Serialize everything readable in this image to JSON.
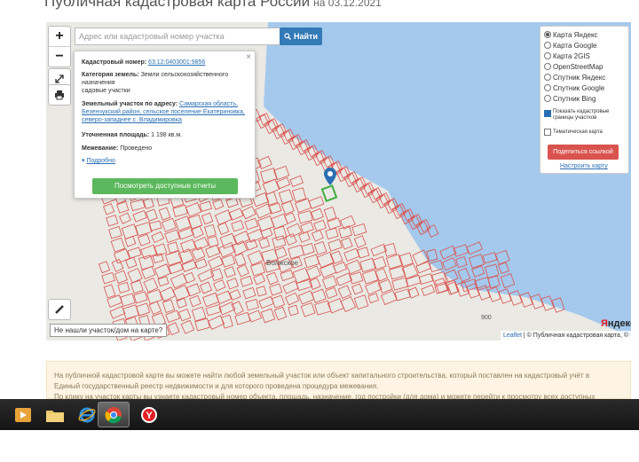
{
  "page": {
    "title": "Публичная кадастровая карта России",
    "date": "на 03.12.2021"
  },
  "map": {
    "search_placeholder": "Адрес или кадастровый номер участка",
    "search_button": "Найти",
    "zoom_in": "+",
    "zoom_out": "−",
    "village_label": "Волжское",
    "plot_label_900": "900",
    "not_found": "Не нашли участок/дом на карте?",
    "attribution_leaflet": "Leaflet",
    "attribution_rest": "| © Публичная кадастровая карта, ©",
    "yandex_logo_y": "Я",
    "yandex_logo_rest": "ндекс",
    "colors": {
      "water": "#a5c9ec",
      "plot_lines": "#d9534f",
      "selected_plot": "#3fae3f"
    }
  },
  "popup": {
    "close": "×",
    "cadastral_label": "Кадастровый номер:",
    "cadastral_value": "63:12:0403001:9856",
    "category_label": "Категория земель:",
    "category_value": "Земли сельскохозяйственного назначения",
    "category_use": "садовые участки",
    "address_label": "Земельный участок по адресу:",
    "address_value": "Самарская область, Безенчукский район, сельское поселение Екатериновка, северо-западнее с. Владимировка",
    "area_label": "Уточненная площадь:",
    "area_value": "1 198 кв.м.",
    "survey_label": "Межевание:",
    "survey_value": "Проведено",
    "more_link": "Подробно",
    "reports_button": "Посмотреть доступные отчеты"
  },
  "layers": {
    "options": [
      {
        "label": "Карта Яндекс",
        "selected": true
      },
      {
        "label": "Карта Google",
        "selected": false
      },
      {
        "label": "Карта 2GIS",
        "selected": false
      },
      {
        "label": "OpenStreetMap",
        "selected": false
      },
      {
        "label": "Спутник Яндекс",
        "selected": false
      },
      {
        "label": "Спутник Google",
        "selected": false
      },
      {
        "label": "Спутник Bing",
        "selected": false
      }
    ],
    "show_borders_label": "Показать кадастровые границы участков",
    "thematic_label": "Тематическая карта",
    "share_button": "Поделиться ссылкой",
    "setup_link": "Настроить карту"
  },
  "info": {
    "line1": "На публичной кадастровой карте вы можете найти любой земельный участок или объект капитального строительства, который поставлен на кадастровый учёт в",
    "line2": "Единый государственный реестр недвижимости и для которого проведена процедура межевания.",
    "line3": "По клику на участок карты вы узнаете кадастровый номер объекта, площадь, назначение, год постройки (для дома) и можете перейти к просмотру всех доступных"
  },
  "taskbar": {
    "apps": [
      {
        "icon": "start-orb-icon"
      },
      {
        "icon": "media-player-icon"
      },
      {
        "icon": "explorer-folder-icon"
      },
      {
        "icon": "internet-explorer-icon"
      },
      {
        "icon": "chrome-icon",
        "active": true
      },
      {
        "icon": "yandex-browser-icon"
      }
    ]
  }
}
